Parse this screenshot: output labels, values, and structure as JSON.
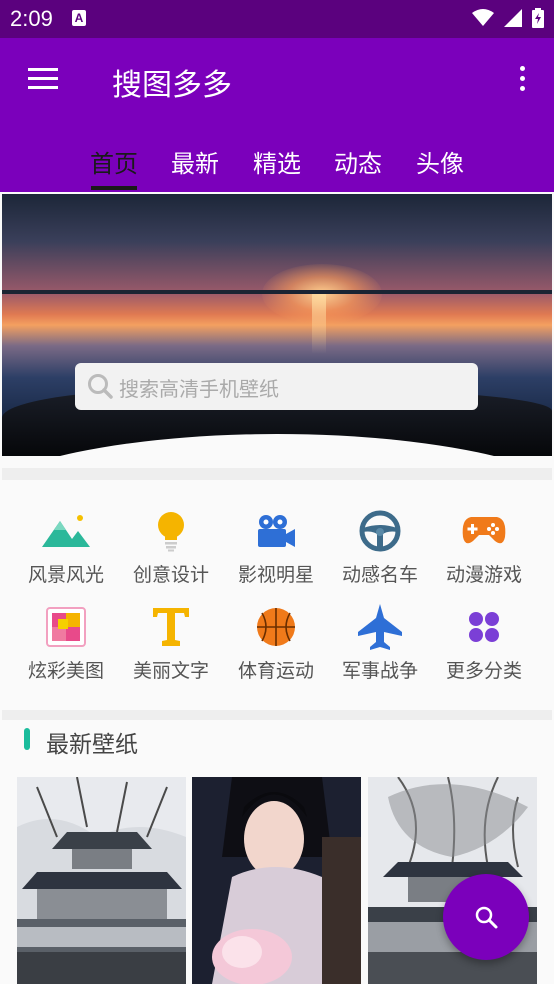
{
  "status_bar": {
    "time": "2:09",
    "app_icon": "A"
  },
  "app_bar": {
    "title": "搜图多多"
  },
  "tabs": [
    {
      "label": "首页",
      "active": true
    },
    {
      "label": "最新",
      "active": false
    },
    {
      "label": "精选",
      "active": false
    },
    {
      "label": "动态",
      "active": false
    },
    {
      "label": "头像",
      "active": false
    }
  ],
  "search": {
    "placeholder": "搜索高清手机壁纸"
  },
  "categories": [
    {
      "label": "风景风光",
      "icon": "mountain-icon",
      "color": "#2bb89a"
    },
    {
      "label": "创意设计",
      "icon": "lightbulb-icon",
      "color": "#f5b400"
    },
    {
      "label": "影视明星",
      "icon": "video-camera-icon",
      "color": "#2e6fd6"
    },
    {
      "label": "动感名车",
      "icon": "steering-wheel-icon",
      "color": "#3d6b8a"
    },
    {
      "label": "动漫游戏",
      "icon": "gamepad-icon",
      "color": "#f07a1a"
    },
    {
      "label": "炫彩美图",
      "icon": "colorful-picture-icon",
      "color": "#e84a8a"
    },
    {
      "label": "美丽文字",
      "icon": "text-t-icon",
      "color": "#f5b400"
    },
    {
      "label": "体育运动",
      "icon": "basketball-icon",
      "color": "#f07a1a"
    },
    {
      "label": "军事战争",
      "icon": "fighter-jet-icon",
      "color": "#2e6fd6"
    },
    {
      "label": "更多分类",
      "icon": "four-dots-icon",
      "color": "#7b3fd6"
    }
  ],
  "latest": {
    "title": "最新壁纸"
  },
  "colors": {
    "primary": "#7b00bb",
    "status": "#5b017e",
    "accent": "#1abc9c"
  }
}
